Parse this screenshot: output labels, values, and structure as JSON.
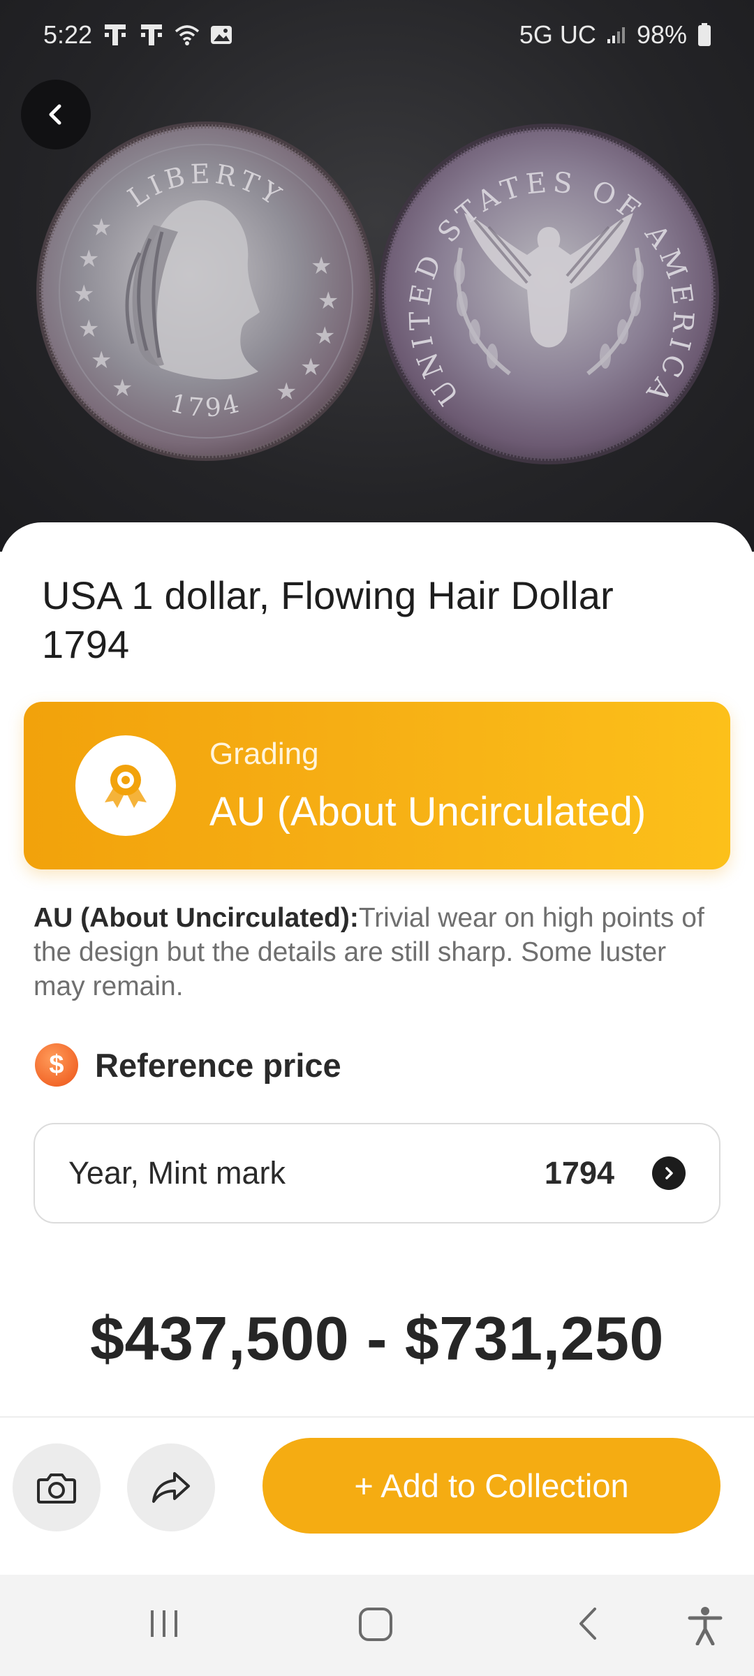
{
  "status_bar": {
    "time": "5:22",
    "network": "5G UC",
    "battery": "98%"
  },
  "hero": {
    "back_icon": "chevron-left-icon",
    "coin_front_legend": "LIBERTY",
    "coin_front_year": "1794",
    "coin_back_legend": "UNITED STATES OF AMERICA"
  },
  "coin": {
    "title": "USA 1 dollar, Flowing Hair Dollar 1794"
  },
  "grading": {
    "label": "Grading",
    "value": "AU (About Uncirculated)",
    "icon": "award-ribbon-icon"
  },
  "description": {
    "term": "AU (About Uncirculated):",
    "text": "Trivial wear on high points of the design but the details are still sharp. Some luster may remain."
  },
  "reference_price": {
    "icon_glyph": "$",
    "label": "Reference price",
    "selector_label": "Year, Mint mark",
    "selector_value": "1794",
    "range": "$437,500 - $731,250"
  },
  "actions": {
    "camera_icon": "camera-icon",
    "share_icon": "share-icon",
    "add_label": "+ Add to Collection"
  },
  "colors": {
    "accent": "#f5ac12",
    "price_icon": "#f2682a",
    "text_dark": "#262626"
  }
}
